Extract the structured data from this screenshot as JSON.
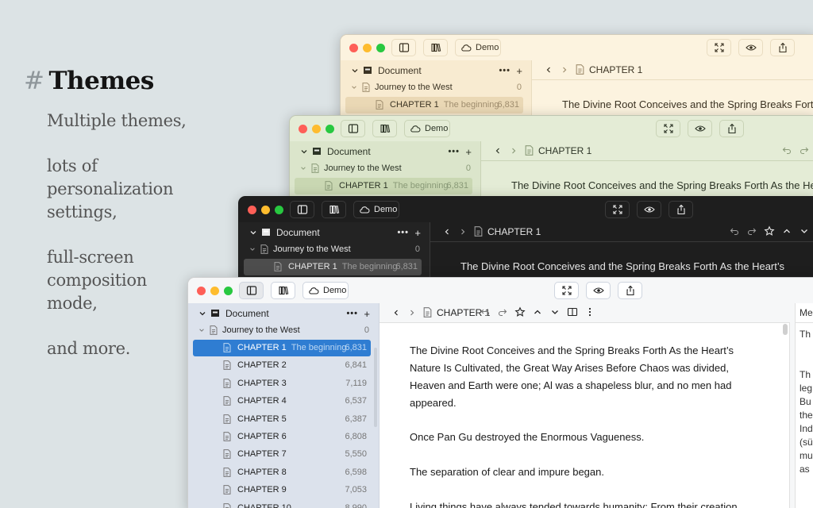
{
  "hero": {
    "hash": "#",
    "title": "Themes"
  },
  "bullets": [
    "Multiple themes,",
    "lots of personalization settings,",
    "full-screen composition mode,",
    "and more."
  ],
  "app": {
    "demo_label": "Demo",
    "sidebar": {
      "document_label": "Document",
      "more_label": "•••",
      "add_label": "+",
      "book_label": "Journey to the West",
      "book_count": "0"
    },
    "chapter_sub": "The beginning",
    "chapters": [
      {
        "label": "CHAPTER 1",
        "count": "6,831"
      },
      {
        "label": "CHAPTER 2",
        "count": "6,841"
      },
      {
        "label": "CHAPTER 3",
        "count": "7,119"
      },
      {
        "label": "CHAPTER 4",
        "count": "6,537"
      },
      {
        "label": "CHAPTER 5",
        "count": "6,387"
      },
      {
        "label": "CHAPTER 6",
        "count": "6,808"
      },
      {
        "label": "CHAPTER 7",
        "count": "5,550"
      },
      {
        "label": "CHAPTER 8",
        "count": "6,598"
      },
      {
        "label": "CHAPTER 9",
        "count": "7,053"
      },
      {
        "label": "CHAPTER 10",
        "count": "8,990"
      }
    ],
    "editor_title": "CHAPTER 1",
    "heading_line": "The Divine Root Conceives and the Spring Breaks Forth As the Heart’s",
    "paragraphs": [
      "The Divine Root Conceives and the Spring Breaks Forth As the Heart’s Nature Is Cultivated, the Great Way Arises Before Chaos was divided, Heaven and Earth were one; Al was a shapeless blur, and no men had appeared.",
      "Once Pan Gu destroyed the Enormous Vagueness.",
      "The separation of clear and impure began.",
      "Living things have always tended towards humanity; From their creation"
    ],
    "right_panel": {
      "head": "Me",
      "lines": [
        "Th",
        "",
        "Th",
        "leg",
        "Bu",
        "the",
        "Ind",
        "(sü",
        "mu",
        "as"
      ]
    }
  },
  "themes": [
    {
      "name": "cream",
      "bg": "#fcf3df",
      "side": "#f8ebd1",
      "sel": "#ead8b5",
      "text": "#3b3323",
      "muted": "#a08e6f",
      "border": "#e9dcc0"
    },
    {
      "name": "green",
      "bg": "#e4ecd6",
      "side": "#dbe5cb",
      "sel": "#c9d7b2",
      "text": "#2c3426",
      "muted": "#8a9a78",
      "border": "#c9d3b6"
    },
    {
      "name": "dark",
      "bg": "#1e1e1e",
      "side": "#232323",
      "sel": "#4d4d4d",
      "text": "#e6e6e6",
      "muted": "#9c9c9c",
      "border": "#3a3a3a"
    },
    {
      "name": "light",
      "bg": "#f6f7f8",
      "side": "#dce2ec",
      "sel": "#2f7dd2",
      "text": "#222222",
      "muted": "#777777",
      "border": "#cfd5df"
    }
  ]
}
